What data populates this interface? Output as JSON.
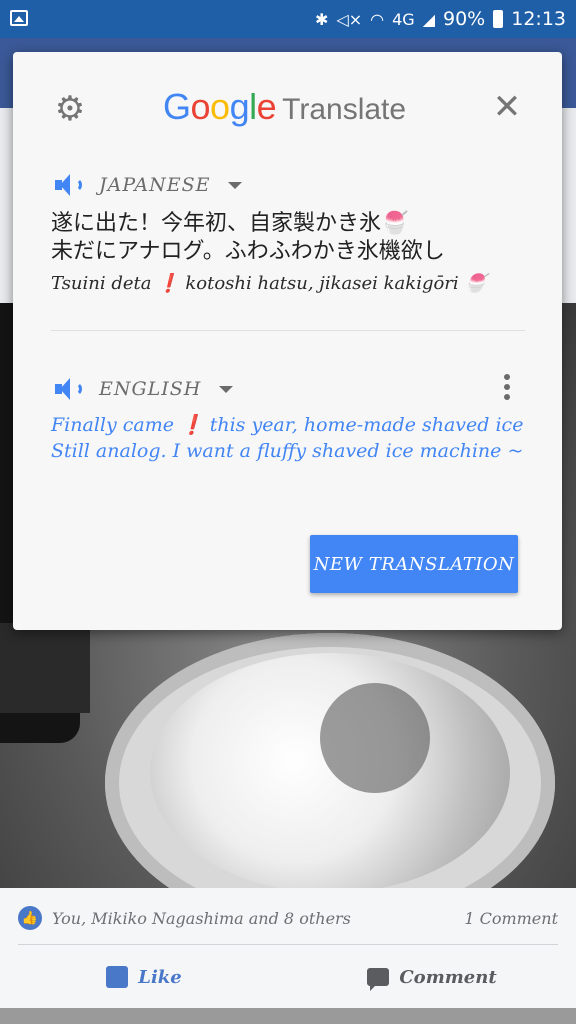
{
  "status_bar": {
    "icons": [
      "image-icon",
      "bluetooth-icon",
      "mute-icon",
      "wifi-icon",
      "lte-icon",
      "signal-icon",
      "battery-icon"
    ],
    "network": "4G",
    "battery": "90%",
    "time": "12:13"
  },
  "translate_card": {
    "brand": {
      "google": "Google",
      "translate": "Translate"
    },
    "source": {
      "language": "JAPANESE",
      "text_line1": "遂に出た！今年初、自家製かき氷🍧",
      "text_line2": "未だにアナログ。ふわふわかき氷機欲し",
      "romanization": "Tsuini deta ❗ kotoshi hatsu, jikasei kakigōri 🍧"
    },
    "target": {
      "language": "ENGLISH",
      "line1": "Finally came ❗ this year, home-made shaved ice",
      "line2": "Still analog. I want a fluffy shaved ice machine ~"
    },
    "new_translation_label": "NEW TRANSLATION",
    "colors": {
      "accent": "#4285f4",
      "google_blue": "#4285f4",
      "google_red": "#ea4335",
      "google_yellow": "#fbbc05",
      "google_green": "#34a853"
    }
  },
  "post": {
    "reactions_text": "You, Mikiko Nagashima and 8 others",
    "comment_count": "1 Comment",
    "like_label": "Like",
    "comment_label": "Comment"
  }
}
